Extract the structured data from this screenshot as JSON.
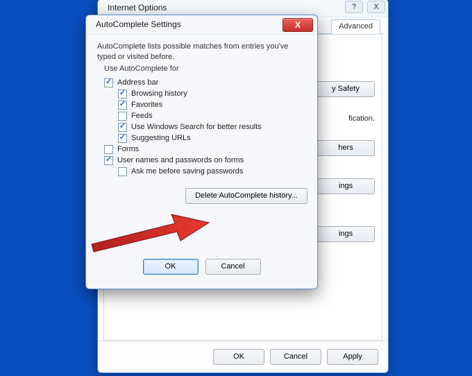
{
  "parent": {
    "title": "Internet Options",
    "tabs": {
      "advanced": "Advanced"
    },
    "rightButtons": {
      "safety": "y Safety",
      "others": "hers",
      "ings1": "ings",
      "ings2": "ings"
    },
    "rightText": "fication.",
    "footer": {
      "ok": "OK",
      "cancel": "Cancel",
      "apply": "Apply"
    }
  },
  "modal": {
    "title": "AutoComplete Settings",
    "close": "X",
    "description": "AutoComplete lists possible matches from entries you've typed or visited before.",
    "subHeader": "Use AutoComplete for",
    "checkboxes": {
      "addressBar": "Address bar",
      "browsingHistory": "Browsing history",
      "favorites": "Favorites",
      "feeds": "Feeds",
      "windowsSearch": "Use Windows Search for better results",
      "suggestingUrls": "Suggesting URLs",
      "forms": "Forms",
      "userPasswords": "User names and passwords on forms",
      "askBeforeSaving": "Ask me before saving passwords"
    },
    "deleteButtonLabel": "Delete AutoComplete history...",
    "footer": {
      "ok": "OK",
      "cancel": "Cancel"
    }
  }
}
